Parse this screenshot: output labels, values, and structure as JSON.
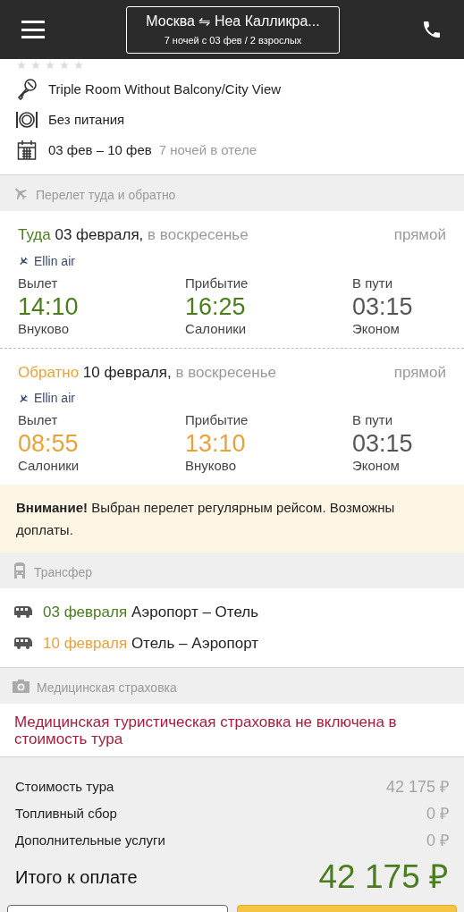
{
  "header": {
    "route": "Москва ⇋ Неа Калликра...",
    "summary": "7 ночей с 03 фев / 2 взрослых"
  },
  "hotel": {
    "stars": 0,
    "room": "Triple Room Without Balcony/City View",
    "meal": "Без питания",
    "dates": "03 фев – 10 фев",
    "nights": "7 ночей в отеле"
  },
  "flight_section": {
    "title": "Перелет туда и обратно",
    "legs": [
      {
        "kind": "outbound",
        "label": "Туда",
        "date": "03 февраля,",
        "weekday": "в воскресенье",
        "type": "прямой",
        "airline": "Ellin air",
        "columns": [
          {
            "label": "Вылет",
            "time": "14:10",
            "place": "Внуково"
          },
          {
            "label": "Прибытие",
            "time": "16:25",
            "place": "Салоники"
          },
          {
            "label": "В пути",
            "time": "03:15",
            "place": "Эконом"
          }
        ]
      },
      {
        "kind": "return",
        "label": "Обратно",
        "date": "10 февраля,",
        "weekday": "в воскресенье",
        "type": "прямой",
        "airline": "Ellin air",
        "columns": [
          {
            "label": "Вылет",
            "time": "08:55",
            "place": "Салоники"
          },
          {
            "label": "Прибытие",
            "time": "13:10",
            "place": "Внуково"
          },
          {
            "label": "В пути",
            "time": "03:15",
            "place": "Эконом"
          }
        ]
      }
    ]
  },
  "notice": "**Внимание!** Выбран перелет регулярным рейсом. Возможны доплаты.",
  "transfer_section": {
    "title": "Трансфер",
    "items": [
      {
        "kind": "outbound",
        "date": "03 февраля",
        "route": "Аэропорт – Отель"
      },
      {
        "kind": "return",
        "date": "10 февраля",
        "route": "Отель – Аэропорт"
      }
    ]
  },
  "insurance_section": {
    "title": "Медицинская страховка",
    "message": "Медицинская туристическая страховка не включена в стоимость тура"
  },
  "totals": {
    "rows": [
      {
        "label": "Стоимость тура",
        "value": "42 175 ₽"
      },
      {
        "label": "Топливный сбор",
        "value": "0 ₽"
      },
      {
        "label": "Дополнительные услуги",
        "value": "0 ₽"
      }
    ],
    "total_label": "Итого к оплате",
    "total_value": "42 175 ₽"
  }
}
